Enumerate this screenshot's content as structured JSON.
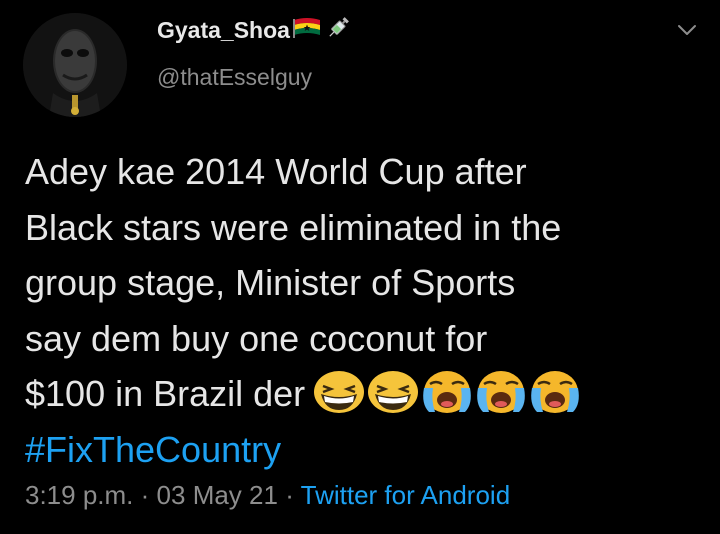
{
  "author": {
    "display_name": "Gyata_Shoa",
    "handle": "@thatEsselguy",
    "flag_icon": "ghana-flag-icon",
    "badge_icon": "syringe-icon"
  },
  "tweet": {
    "lines": [
      "Adey kae 2014 World Cup after",
      "Black stars were eliminated in the",
      "group stage, Minister of Sports",
      "say dem buy one coconut for",
      "$100 in Brazil der"
    ],
    "emojis": [
      "grinning-squint-face",
      "grinning-squint-face",
      "loudly-crying-face",
      "loudly-crying-face",
      "loudly-crying-face"
    ],
    "hashtag": "#FixTheCountry"
  },
  "meta": {
    "time": "3:19 p.m.",
    "separator": "·",
    "date": "03 May 21",
    "source": "Twitter for Android"
  },
  "colors": {
    "background": "#000000",
    "text": "#e6e6e6",
    "secondary": "#8d8d8d",
    "link": "#1da1f2"
  }
}
